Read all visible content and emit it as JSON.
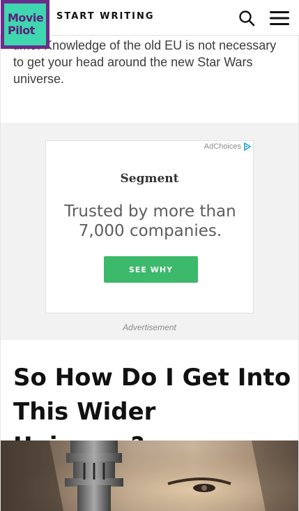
{
  "header": {
    "logo_text": "Movie\nPilot",
    "start_writing": "START WRITING"
  },
  "article": {
    "paragraph": "being introduced to those elements for the first time. Knowledge of the old EU is not necessary to get your head around the new Star Wars universe.",
    "heading": "So How Do I Get Into This Wider Universe?"
  },
  "ad": {
    "adchoices": "AdChoices",
    "brand": "Segment",
    "headline": "Trusted by more than 7,000 companies.",
    "cta": "SEE WHY",
    "caption": "Advertisement",
    "cta_color": "#3cb96a"
  },
  "colors": {
    "logo_border": "#6b2d8a",
    "logo_fill": "#3fd6b0",
    "ad_background": "#f2f2f2"
  },
  "icons": [
    "search-icon",
    "hamburger-menu-icon",
    "adchoices-icon"
  ]
}
